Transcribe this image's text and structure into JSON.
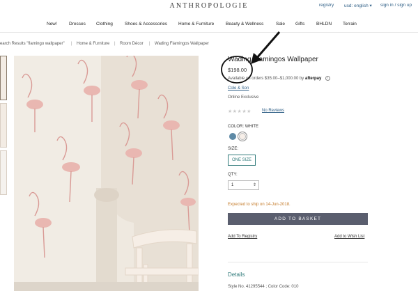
{
  "header": {
    "logo": "ANTHROPOLOGIE",
    "registry": "registry",
    "currency": "usd: english ▾",
    "sign_in": "sign in / sign up"
  },
  "nav": {
    "items": [
      "New!",
      "Dresses",
      "Clothing",
      "Shoes & Accessories",
      "Home & Furniture",
      "Beauty & Wellness",
      "Sale",
      "Gifts",
      "BHLDN",
      "Terrain"
    ]
  },
  "breadcrumb": {
    "items": [
      "earch Results \"flamingo wallpaper\"",
      "Home & Furniture",
      "Room Décor",
      "Wading Flamingos Wallpaper"
    ],
    "separator": "|"
  },
  "product": {
    "title": "Wading Flamingos Wallpaper",
    "price": "$198.00",
    "afterpay_text": "Available on orders $35.00–$1,000.00 by",
    "afterpay_logo": "afterpay",
    "info_icon": "i",
    "brand": "Cole & Son",
    "exclusive": "Online Exclusive",
    "stars": "★★★★★",
    "reviews": "No Reviews",
    "color_label": "COLOR:",
    "color_value": "WHITE",
    "size_label": "SIZE:",
    "size_value": "ONE SIZE",
    "qty_label": "QTY:",
    "qty_value": "1",
    "ship_text": "Expected to ship on 14-Jun-2018.",
    "add_to_basket": "ADD TO BASKET",
    "add_registry": "Add To Registry",
    "add_wishlist": "Add to Wish List",
    "details_heading": "Details",
    "style_no": "Style No. 41295544 ; Color Code: 010"
  },
  "colors": {
    "swatch_blue": "#5e8aa6",
    "swatch_white": "#f7efe9",
    "basket_bg": "#5a5e6e",
    "accent_teal": "#2f7a7a",
    "ship_orange": "#c47b2a"
  },
  "icons": [
    "info-icon",
    "chevron-down-icon",
    "star-icon"
  ]
}
